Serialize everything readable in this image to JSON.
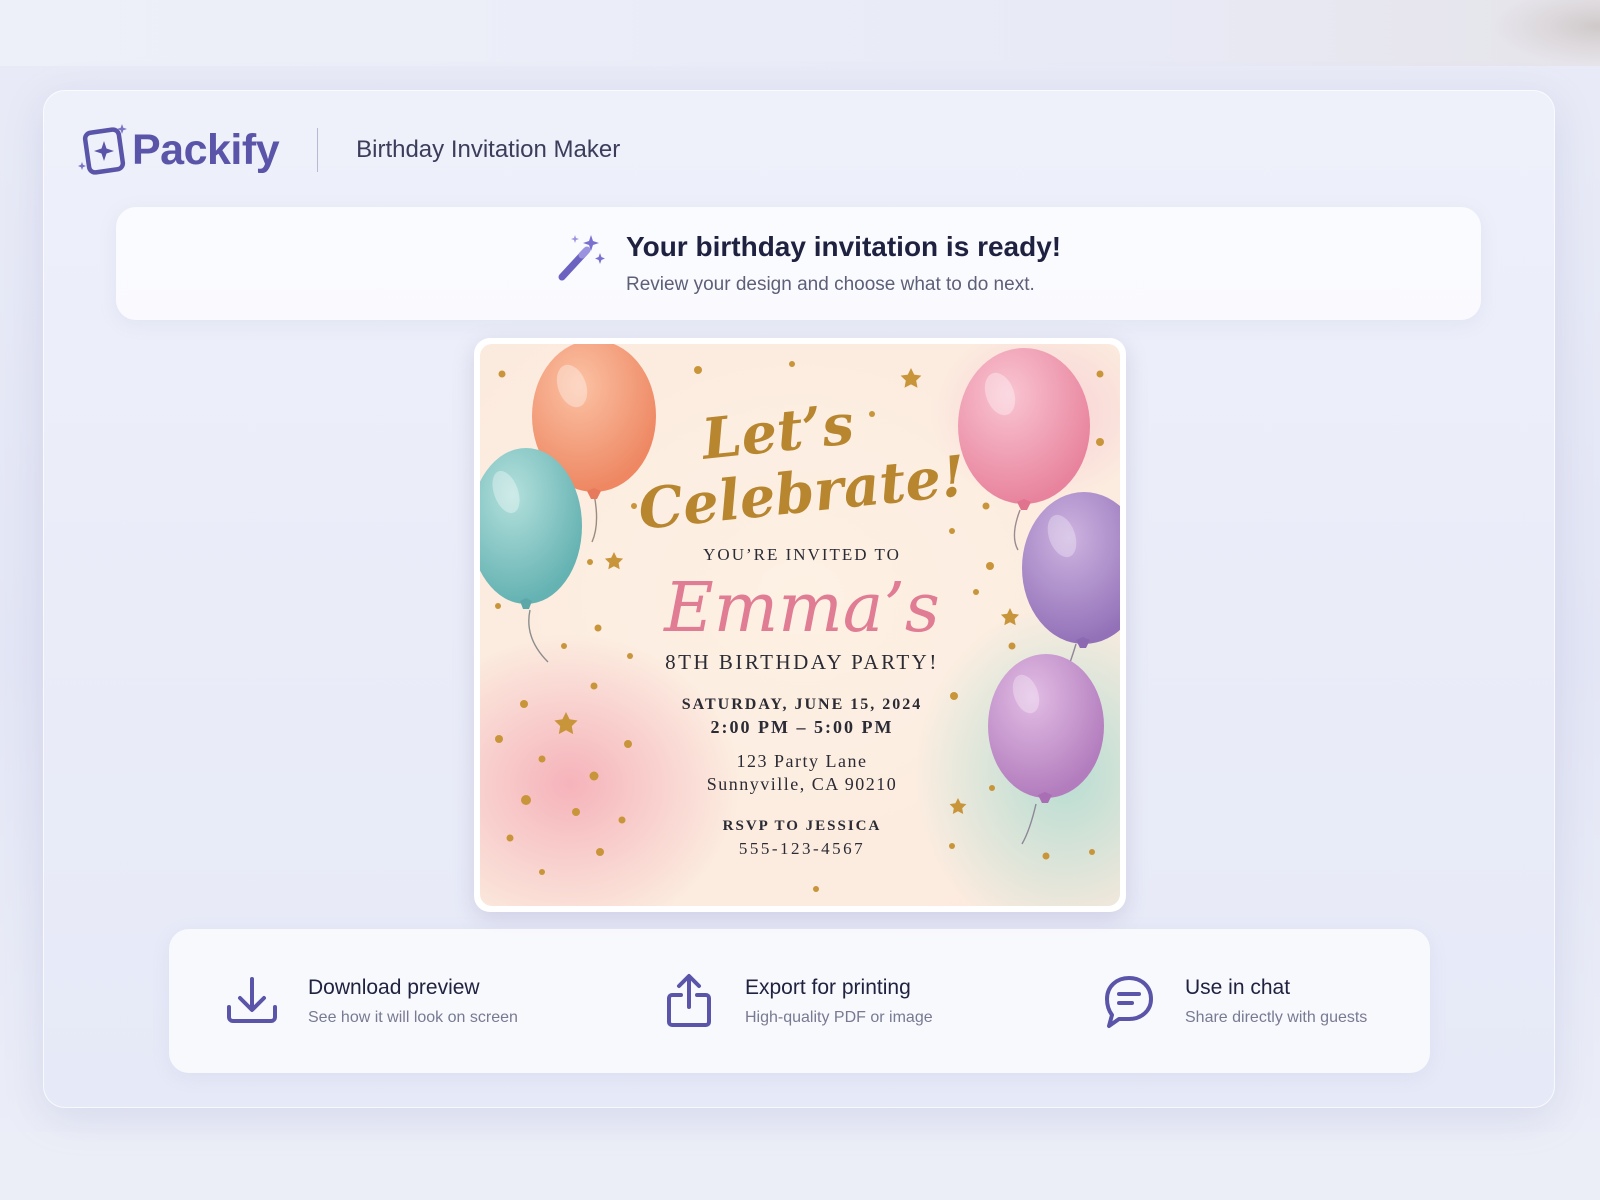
{
  "app": {
    "brand": "Packify",
    "title": "Birthday Invitation Maker",
    "accent_color": "#5a55a8"
  },
  "banner": {
    "icon": "magic-wand-icon",
    "title": "Your birthday invitation is ready!",
    "subtitle": "Review your design and choose what to do next."
  },
  "invitation": {
    "headline_line1": "Let’s",
    "headline_line2": "Celebrate!",
    "invited_to": "YOU’RE INVITED TO",
    "name": "Emma’s",
    "occasion": "8TH BIRTHDAY PARTY!",
    "date": "SATURDAY, JUNE 15, 2024",
    "time": "2:00 PM – 5:00 PM",
    "address_line1": "123 Party Lane",
    "address_line2": "Sunnyville, CA 90210",
    "rsvp": "RSVP TO JESSICA",
    "phone": "555-123-4567",
    "colors": {
      "gold": "#b8862f",
      "pink": "#e07c93",
      "balloon_orange": "#f29a74",
      "balloon_teal": "#7fc2c0",
      "balloon_pink": "#ef99ae",
      "balloon_purple": "#a884c4",
      "balloon_lilac": "#c58fc8"
    }
  },
  "actions": [
    {
      "icon": "download-icon",
      "label": "Download preview",
      "sublabel": "See how it will look on screen"
    },
    {
      "icon": "share-export-icon",
      "label": "Export for printing",
      "sublabel": "High-quality PDF or image"
    },
    {
      "icon": "chat-bubble-icon",
      "label": "Use in chat",
      "sublabel": "Share directly with guests"
    }
  ]
}
